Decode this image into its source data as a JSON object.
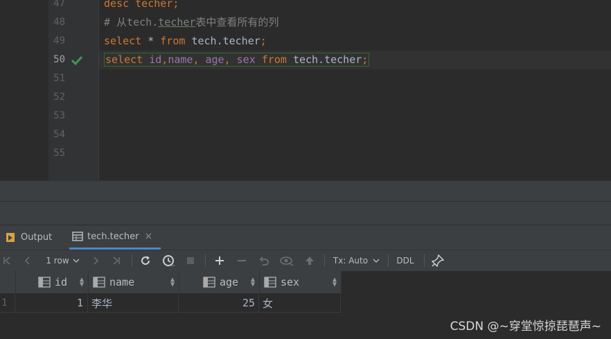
{
  "editor": {
    "lines": [
      {
        "num": "47",
        "tokens": [
          {
            "t": "desc techer;",
            "c": "kw"
          }
        ]
      },
      {
        "num": "48",
        "tokens": [
          {
            "t": "# 从tech.",
            "c": "cm"
          },
          {
            "t": "techer",
            "c": "cm"
          },
          {
            "t": "表中查看所有的列",
            "c": "cm"
          }
        ]
      },
      {
        "num": "49",
        "tokens": [
          {
            "t": "select ",
            "c": "kw"
          },
          {
            "t": "* ",
            "c": "tx"
          },
          {
            "t": "from ",
            "c": "kw"
          },
          {
            "t": "tech.techer",
            "c": "tx"
          },
          {
            "t": ";",
            "c": "kw"
          }
        ]
      },
      {
        "num": "50",
        "tokens": [
          {
            "t": "select ",
            "c": "kw"
          },
          {
            "t": "id",
            "c": "col"
          },
          {
            "t": ",",
            "c": "kw"
          },
          {
            "t": "name",
            "c": "col"
          },
          {
            "t": ", ",
            "c": "kw"
          },
          {
            "t": "age",
            "c": "col"
          },
          {
            "t": ", ",
            "c": "kw"
          },
          {
            "t": "sex ",
            "c": "col"
          },
          {
            "t": "from ",
            "c": "kw"
          },
          {
            "t": "tech.techer",
            "c": "tx"
          },
          {
            "t": ";",
            "c": "kw"
          }
        ]
      },
      {
        "num": "51",
        "tokens": []
      },
      {
        "num": "52",
        "tokens": []
      },
      {
        "num": "53",
        "tokens": []
      },
      {
        "num": "54",
        "tokens": []
      },
      {
        "num": "55",
        "tokens": []
      }
    ],
    "current_line": "50",
    "status_icon": "checkmark-icon"
  },
  "tabs": [
    {
      "label": "Output",
      "icon": "output-icon",
      "active": false
    },
    {
      "label": "tech.techer",
      "icon": "table-icon",
      "active": true,
      "close": "×"
    }
  ],
  "toolbar": {
    "row_count": "1 row",
    "tx_mode": "Tx: Auto",
    "ddl": "DDL",
    "icons": [
      "first-page-icon",
      "prev-page-icon",
      "next-page-icon",
      "last-page-icon",
      "reload-icon",
      "history-icon",
      "stop-icon",
      "add-row-icon",
      "delete-row-icon",
      "revert-icon",
      "preview-icon",
      "submit-icon",
      "pin-icon"
    ]
  },
  "grid": {
    "columns": [
      "id",
      "name",
      "age",
      "sex"
    ],
    "rows": [
      {
        "rownum": "1",
        "id": "1",
        "name": "李华",
        "age": "25",
        "sex": "女"
      }
    ]
  },
  "watermark": "CSDN @~穿堂惊掠琵琶声~",
  "colors": {
    "keyword": "#cc7832",
    "column": "#9876aa",
    "comment": "#808080",
    "text": "#a9b7c6",
    "accent": "#4a88c7",
    "success": "#3d9a4f"
  }
}
